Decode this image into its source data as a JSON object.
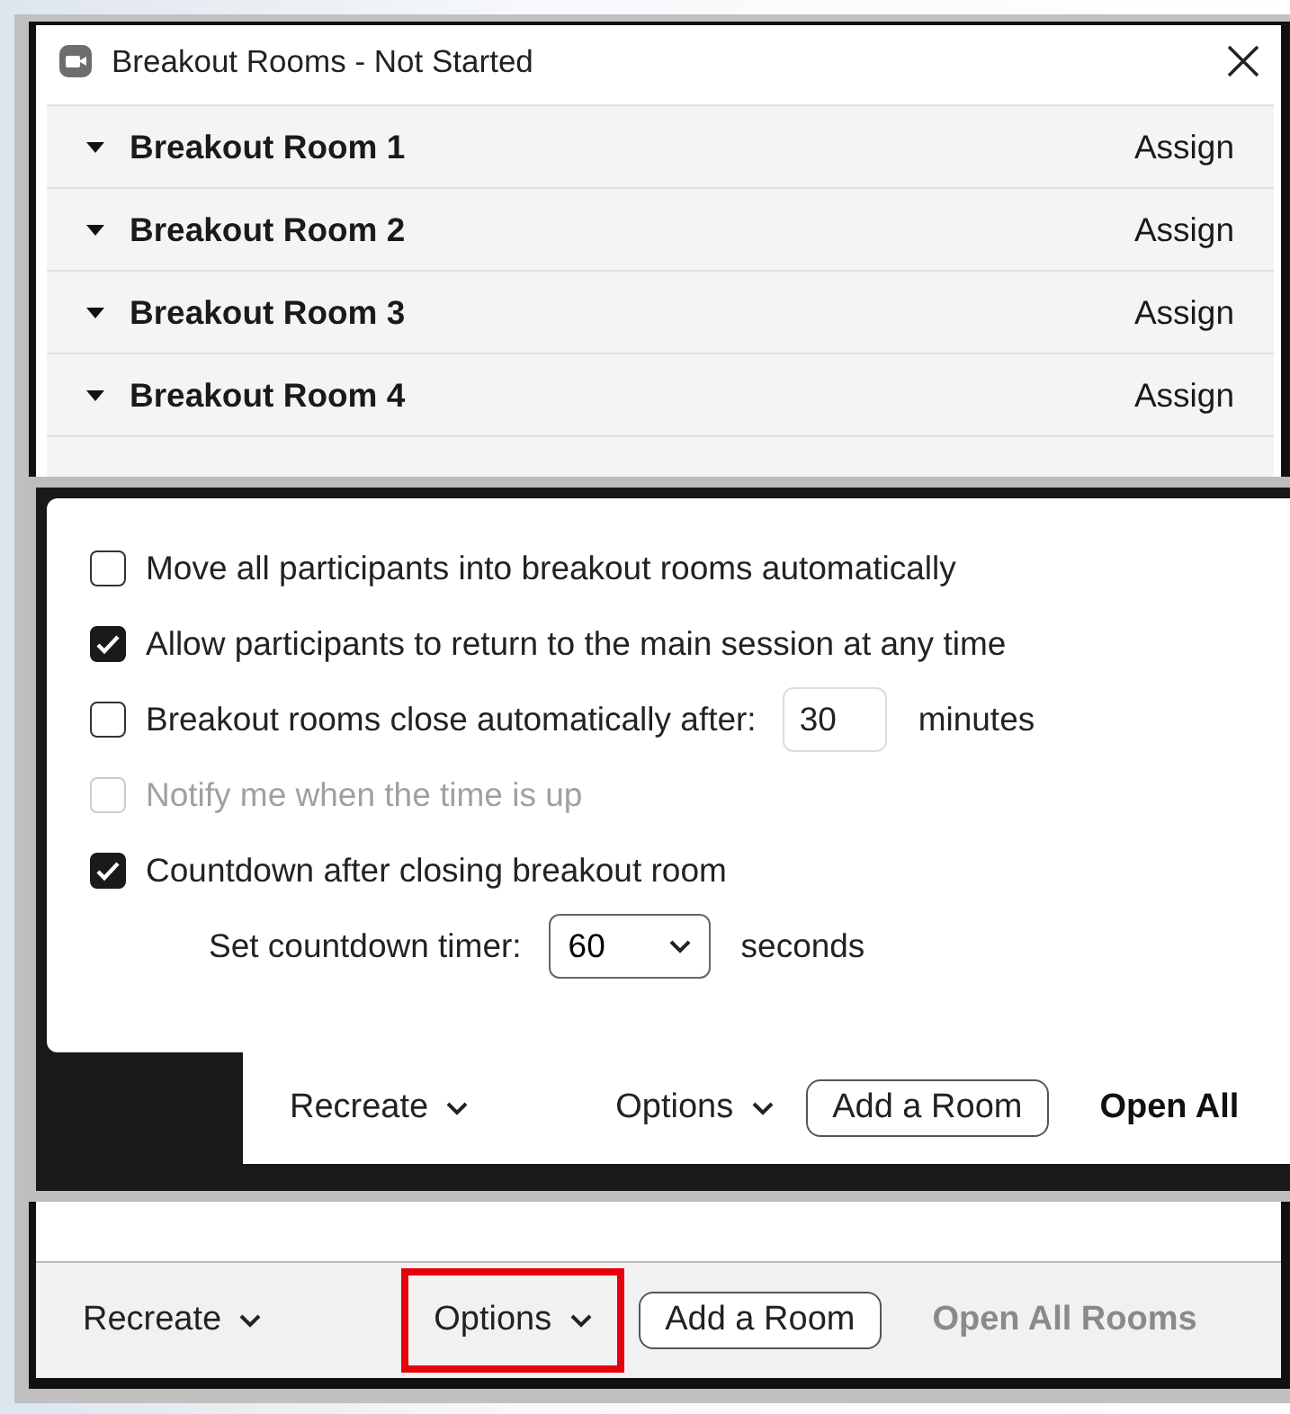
{
  "window": {
    "title": "Breakout Rooms - Not Started"
  },
  "rooms": [
    {
      "name": "Breakout Room 1",
      "action": "Assign"
    },
    {
      "name": "Breakout Room 2",
      "action": "Assign"
    },
    {
      "name": "Breakout Room 3",
      "action": "Assign"
    },
    {
      "name": "Breakout Room 4",
      "action": "Assign"
    }
  ],
  "inset": {
    "options": [
      {
        "kind": "checkbox",
        "label": "Move all participants into breakout rooms automatically",
        "checked": false,
        "disabled": false
      },
      {
        "kind": "checkbox",
        "label": "Allow participants to return to the main session at any time",
        "checked": true,
        "disabled": false
      },
      {
        "kind": "checkbox_input",
        "label": "Breakout rooms close automatically after:",
        "checked": false,
        "disabled": false,
        "value": "30",
        "unit": "minutes"
      },
      {
        "kind": "checkbox",
        "label": "Notify me when the time is up",
        "checked": false,
        "disabled": true
      },
      {
        "kind": "checkbox",
        "label": "Countdown after closing breakout room",
        "checked": true,
        "disabled": false
      },
      {
        "kind": "select",
        "label": "Set countdown timer:",
        "value": "60",
        "unit": "seconds"
      }
    ],
    "toolbar": {
      "recreate": "Recreate",
      "options": "Options",
      "add_room": "Add a Room",
      "open_all": "Open All",
      "open_all_disabled": false
    }
  },
  "toolbar": {
    "recreate": "Recreate",
    "options": "Options",
    "options_highlighted": true,
    "add_room": "Add a Room",
    "open_all": "Open All Rooms",
    "open_all_disabled": true
  }
}
